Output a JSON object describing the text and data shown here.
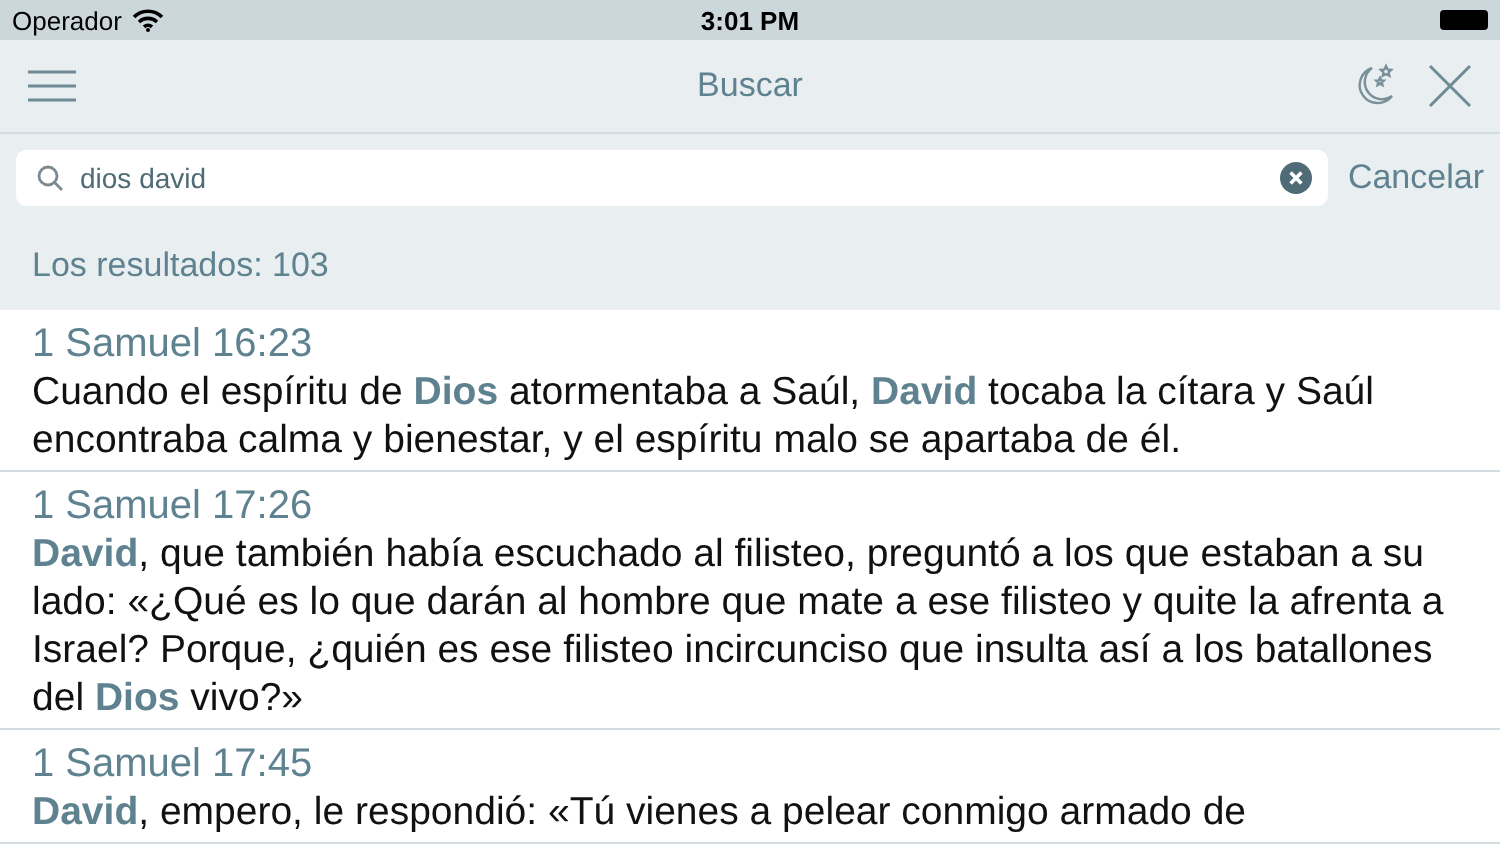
{
  "status_bar": {
    "carrier": "Operador",
    "time": "3:01 PM"
  },
  "nav": {
    "title": "Buscar"
  },
  "search": {
    "value": "dios david",
    "cancel": "Cancelar"
  },
  "results_count": "Los resultados: 103",
  "results": [
    {
      "reference": "1 Samuel 16:23",
      "text": "Cuando el espíritu de **Dios** atormentaba a Saúl, **David** tocaba la cítara y Saúl encontraba calma y bienestar, y el espíritu malo se apartaba de él."
    },
    {
      "reference": "1 Samuel 17:26",
      "text": "**David**, que también había escuchado al filisteo, preguntó a los que estaban a su lado: «¿Qué es lo que darán al hombre que mate a ese filisteo y quite la afrenta a Israel? Porque, ¿quién es ese filisteo incircunciso que insulta así a los batallones del **Dios** vivo?»"
    },
    {
      "reference": "1 Samuel 17:45",
      "text": "**David**, empero, le respondió: «Tú vienes a pelear conmigo armado de"
    }
  ]
}
